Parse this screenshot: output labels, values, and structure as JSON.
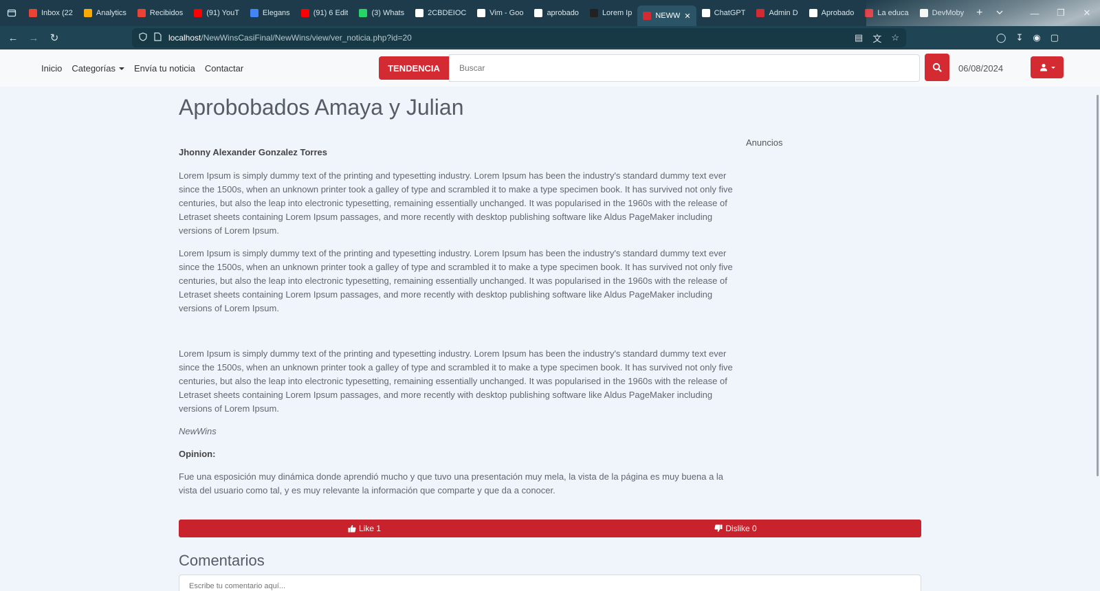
{
  "browser": {
    "tabs": [
      {
        "label": "Inbox (22",
        "color": "#ea4335"
      },
      {
        "label": "Analytics",
        "color": "#f9ab00"
      },
      {
        "label": "Recibidos",
        "color": "#ea4335"
      },
      {
        "label": "(91) YouT",
        "color": "#ff0000"
      },
      {
        "label": "Elegans",
        "color": "#4285f4"
      },
      {
        "label": "(91) 6 Edit",
        "color": "#ff0000"
      },
      {
        "label": "(3) Whats",
        "color": "#25d366"
      },
      {
        "label": "2CBDEIOC",
        "color": "#ffffff"
      },
      {
        "label": "Vim - Goo",
        "color": "#ffffff"
      },
      {
        "label": "aprobado",
        "color": "#ffffff"
      },
      {
        "label": "Lorem Ip",
        "color": "#222222"
      },
      {
        "label": "NEWW",
        "color": "#d42b33",
        "active": true
      },
      {
        "label": "ChatGPT",
        "color": "#ffffff"
      },
      {
        "label": "Admin D",
        "color": "#d42b33"
      },
      {
        "label": "Aprobado",
        "color": "#ffffff"
      },
      {
        "label": "La educa",
        "color": "#e0353d"
      },
      {
        "label": "DevMoby",
        "color": "#ffffff"
      }
    ],
    "close_tab_glyph": "✕",
    "new_tab_glyph": "+",
    "url_host": "localhost",
    "url_path": "/NewWinsCasiFinal/NewWins/view/ver_noticia.php?id=20"
  },
  "nav": {
    "links": [
      "Inicio",
      "Categorías",
      "Envía tu noticia",
      "Contactar"
    ],
    "trend_label": "TENDENCIA",
    "search_placeholder": "Buscar",
    "date": "06/08/2024"
  },
  "article": {
    "title": "Aprobobados Amaya y Julian",
    "author": "Jhonny Alexander Gonzalez Torres",
    "paragraphs": [
      "Lorem Ipsum is simply dummy text of the printing and typesetting industry. Lorem Ipsum has been the industry's standard dummy text ever since the 1500s, when an unknown printer took a galley of type and scrambled it to make a type specimen book. It has survived not only five centuries, but also the leap into electronic typesetting, remaining essentially unchanged. It was popularised in the 1960s with the release of Letraset sheets containing Lorem Ipsum passages, and more recently with desktop publishing software like Aldus PageMaker including versions of Lorem Ipsum.",
      "Lorem Ipsum is simply dummy text of the printing and typesetting industry. Lorem Ipsum has been the industry's standard dummy text ever since the 1500s, when an unknown printer took a galley of type and scrambled it to make a type specimen book. It has survived not only five centuries, but also the leap into electronic typesetting, remaining essentially unchanged. It was popularised in the 1960s with the release of Letraset sheets containing Lorem Ipsum passages, and more recently with desktop publishing software like Aldus PageMaker including versions of Lorem Ipsum.",
      "Lorem Ipsum is simply dummy text of the printing and typesetting industry. Lorem Ipsum has been the industry's standard dummy text ever since the 1500s, when an unknown printer took a galley of type and scrambled it to make a type specimen book. It has survived not only five centuries, but also the leap into electronic typesetting, remaining essentially unchanged. It was popularised in the 1960s with the release of Letraset sheets containing Lorem Ipsum passages, and more recently with desktop publishing software like Aldus PageMaker including versions of Lorem Ipsum."
    ],
    "source": "NewWins",
    "opinion_heading": "Opinion:",
    "opinion_text": "Fue una esposición muy dinámica donde aprendió mucho y que tuvo una presentación muy mela, la vista de la página es muy buena a la vista del usuario como tal,  y es muy relevante la información que comparte y que da a conocer.",
    "ads_label": "Anuncios"
  },
  "reactions": {
    "like_label": "Like 1",
    "dislike_label": "Dislike 0"
  },
  "comments": {
    "heading": "Comentarios",
    "placeholder": "Escribe tu comentario aquí..."
  },
  "colors": {
    "brand_red": "#d42b33",
    "page_bg": "#f0f4fb"
  }
}
